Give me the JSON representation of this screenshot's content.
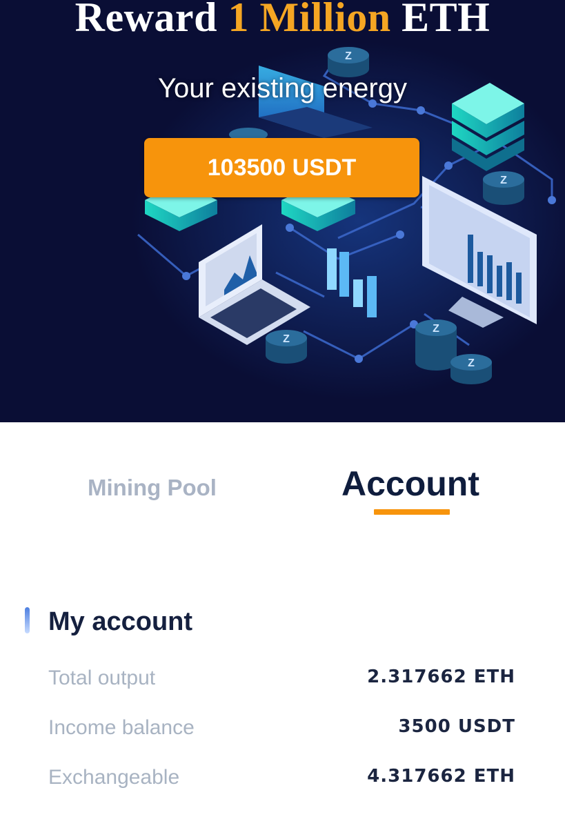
{
  "hero": {
    "headline_prefix": "Reward ",
    "headline_accent": "1 Million",
    "headline_suffix": " ETH",
    "energy_label": "Your existing energy",
    "energy_value": "103500 USDT",
    "icons": [
      "laptop-icon",
      "server-stack-icon",
      "coin-stack-icon",
      "monitor-icon",
      "bar-chart-icon"
    ]
  },
  "tabs": [
    {
      "label": "Mining Pool",
      "active": false
    },
    {
      "label": "Account",
      "active": true
    }
  ],
  "account": {
    "title": "My account",
    "rows": [
      {
        "label": "Total output",
        "value": "2.317662 ETH"
      },
      {
        "label": "Income balance",
        "value": "3500 USDT"
      },
      {
        "label": "Exchangeable",
        "value": "4.317662 ETH"
      }
    ]
  },
  "colors": {
    "hero_background": "#0a0e35",
    "accent_orange": "#f7940c",
    "navy_text": "#0f1d3d",
    "muted_text": "#a8b3c2"
  }
}
